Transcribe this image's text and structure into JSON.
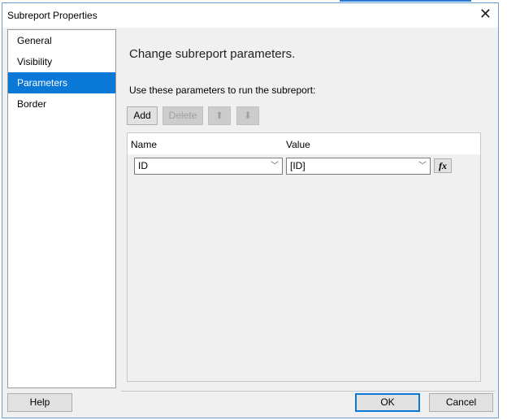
{
  "dialog": {
    "title": "Subreport Properties"
  },
  "sidebar": {
    "items": [
      {
        "label": "General"
      },
      {
        "label": "Visibility"
      },
      {
        "label": "Parameters",
        "selected": true
      },
      {
        "label": "Border"
      }
    ]
  },
  "main": {
    "heading": "Change subreport parameters.",
    "subheading": "Use these parameters to run the subreport:",
    "toolbar": {
      "add": "Add",
      "delete": "Delete"
    },
    "grid": {
      "columns": [
        "Name",
        "Value"
      ],
      "rows": [
        {
          "name": "ID",
          "value": "[ID]"
        }
      ],
      "fx": "fx"
    }
  },
  "footer": {
    "help": "Help",
    "ok": "OK",
    "cancel": "Cancel"
  }
}
